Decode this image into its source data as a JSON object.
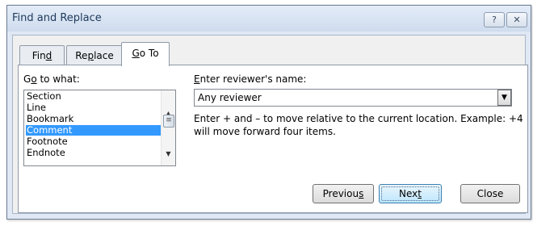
{
  "window": {
    "title": "Find and Replace",
    "help_glyph": "?",
    "close_glyph": "✕"
  },
  "tabs": [
    {
      "label_pre": "Fin",
      "label_key": "d",
      "label_post": ""
    },
    {
      "label_pre": "Re",
      "label_key": "p",
      "label_post": "lace"
    },
    {
      "label_pre": "",
      "label_key": "G",
      "label_post": "o To"
    }
  ],
  "goto": {
    "label_pre": "G",
    "label_key": "o",
    "label_post": " to what:",
    "items": [
      "Section",
      "Line",
      "Bookmark",
      "Comment",
      "Footnote",
      "Endnote"
    ],
    "selected": "Comment"
  },
  "reviewer": {
    "label_pre": "",
    "label_key": "E",
    "label_post": "nter reviewer's name:",
    "value": "Any reviewer"
  },
  "hint": "Enter + and – to move relative to the current location. Example: +4 will move forward four items.",
  "buttons": {
    "previous_pre": "Previou",
    "previous_key": "s",
    "next_pre": "Nex",
    "next_key": "t",
    "close": "Close"
  },
  "icons": {
    "scroll_up": "▲",
    "scroll_down": "▼",
    "thumb_grip": "≡",
    "dropdown": "▼"
  }
}
